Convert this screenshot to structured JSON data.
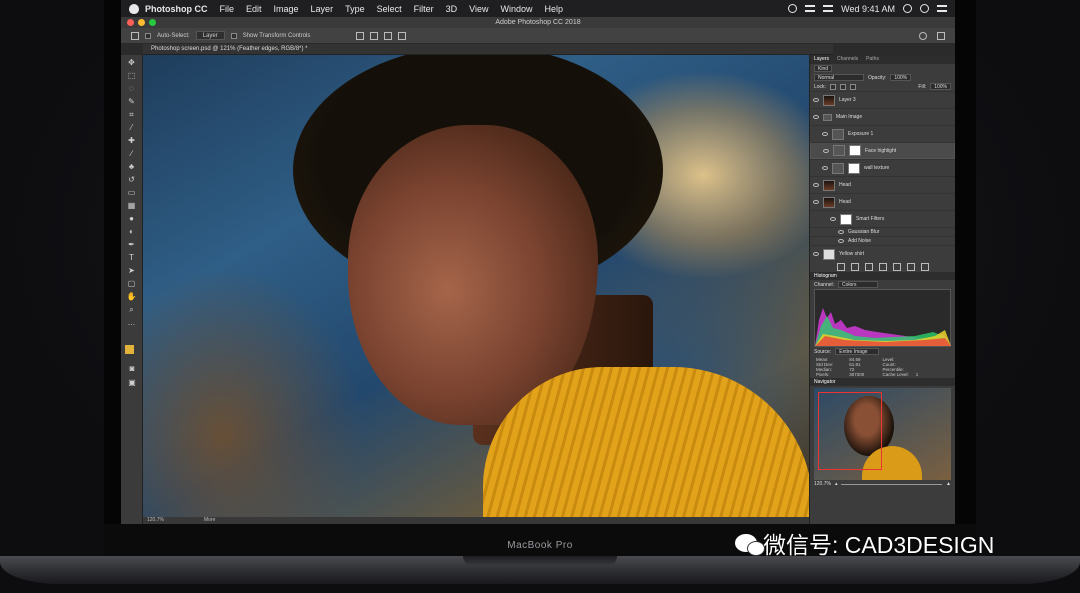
{
  "menubar": {
    "app_name": "Photoshop CC",
    "items": [
      "File",
      "Edit",
      "Image",
      "Layer",
      "Type",
      "Select",
      "Filter",
      "3D",
      "View",
      "Window",
      "Help"
    ],
    "clock": "Wed 9:41 AM"
  },
  "window": {
    "title": "Adobe Photoshop CC 2018"
  },
  "options_bar": {
    "auto_select_label": "Auto-Select:",
    "auto_select_value": "Layer",
    "transform_label": "Show Transform Controls"
  },
  "document": {
    "tab_label": "Photoshop screen.psd @ 121% (Feather edges, RGB/8*) *"
  },
  "status_bar": {
    "zoom": "120.7%",
    "more": "More"
  },
  "layers_panel": {
    "tabs": [
      "Layers",
      "Channels",
      "Paths"
    ],
    "filter_label": "Kind",
    "blend_mode": "Normal",
    "opacity_label": "Opacity:",
    "opacity_value": "100%",
    "lock_label": "Lock:",
    "fill_label": "Fill:",
    "fill_value": "100%",
    "layers": [
      {
        "name": "Layer 3"
      },
      {
        "name": "Main Image"
      },
      {
        "name": "Exposure 1"
      },
      {
        "name": "Face highlight"
      },
      {
        "name": "wall texture"
      },
      {
        "name": "Head"
      },
      {
        "name": "Head"
      },
      {
        "name": "Smart Filters"
      },
      {
        "name": "Gaussian Blur"
      },
      {
        "name": "Add Noise"
      },
      {
        "name": "Yellow shirt"
      }
    ]
  },
  "histogram_panel": {
    "title": "Histogram",
    "channel_label": "Channel:",
    "channel_value": "Colors",
    "source_label": "Source:",
    "source_value": "Entire Image",
    "stats": [
      {
        "label": "Mean:",
        "value": "84.59",
        "label2": "Level:",
        "value2": ""
      },
      {
        "label": "Std Dev:",
        "value": "61.81",
        "label2": "Count:",
        "value2": ""
      },
      {
        "label": "Median:",
        "value": "72",
        "label2": "Percentile:",
        "value2": ""
      },
      {
        "label": "Pixels:",
        "value": "307200",
        "label2": "Cache Level:",
        "value2": "1"
      }
    ]
  },
  "navigator_panel": {
    "title": "Navigator",
    "zoom": "120.7%"
  },
  "laptop": {
    "brand": "MacBook Pro"
  },
  "watermark": {
    "text": "微信号: CAD3DESIGN"
  }
}
